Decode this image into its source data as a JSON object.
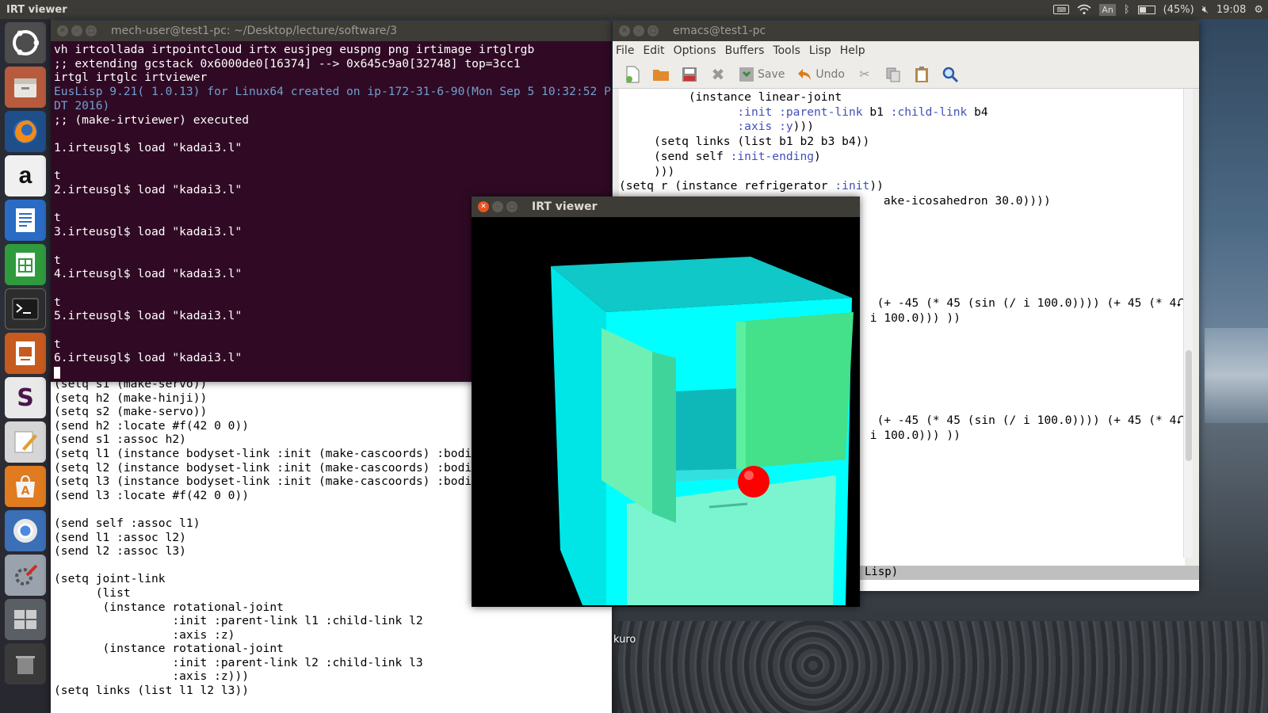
{
  "top_panel": {
    "app_title": "IRT viewer",
    "lang_indicator": "An",
    "battery": "(45%)",
    "battery_level": 0.45,
    "clock": "19:08"
  },
  "launcher": {
    "items": [
      "ubuntu-dash",
      "files",
      "firefox",
      "amazon",
      "writer",
      "calc",
      "terminal",
      "impress",
      "slack",
      "text-editor",
      "software-center",
      "chromium",
      "settings",
      "workspace-switcher",
      "trash"
    ]
  },
  "terminal": {
    "title": "mech-user@test1-pc: ~/Desktop/lecture/software/3",
    "lines": [
      {
        "text": "vh irtcollada irtpointcloud irtx eusjpeg euspng png irtimage irtglrgb",
        "style": "normal"
      },
      {
        "text": ";; extending gcstack 0x6000de0[16374] --> 0x645c9a0[32748] top=3cc1",
        "style": "normal"
      },
      {
        "text": "irtgl irtglc irtviewer",
        "style": "normal"
      },
      {
        "text": "EusLisp 9.21( 1.0.13) for Linux64 created on ip-172-31-6-90(Mon Sep 5 10:32:52 P",
        "style": "info"
      },
      {
        "text": "DT 2016)",
        "style": "info"
      },
      {
        "text": ";; (make-irtviewer) executed",
        "style": "normal"
      },
      {
        "text": "",
        "style": "normal"
      },
      {
        "text": "1.irteusgl$ load \"kadai3.l\"",
        "style": "normal"
      },
      {
        "text": "",
        "style": "normal"
      },
      {
        "text": "t",
        "style": "normal"
      },
      {
        "text": "2.irteusgl$ load \"kadai3.l\"",
        "style": "normal"
      },
      {
        "text": "",
        "style": "normal"
      },
      {
        "text": "t",
        "style": "normal"
      },
      {
        "text": "3.irteusgl$ load \"kadai3.l\"",
        "style": "normal"
      },
      {
        "text": "",
        "style": "normal"
      },
      {
        "text": "t",
        "style": "normal"
      },
      {
        "text": "4.irteusgl$ load \"kadai3.l\"",
        "style": "normal"
      },
      {
        "text": "",
        "style": "normal"
      },
      {
        "text": "t",
        "style": "normal"
      },
      {
        "text": "5.irteusgl$ load \"kadai3.l\"",
        "style": "normal"
      },
      {
        "text": "",
        "style": "normal"
      },
      {
        "text": "t",
        "style": "normal"
      },
      {
        "text": "6.irteusgl$ load \"kadai3.l\"",
        "style": "normal"
      }
    ]
  },
  "left_editor": {
    "lines": [
      "(setq s1 (make-servo))",
      "(setq h2 (make-hinji))",
      "(setq s2 (make-servo))",
      "(send h2 :locate #f(42 0 0))",
      "(send s1 :assoc h2)",
      "(setq l1 (instance bodyset-link :init (make-cascoords) :bodi",
      "(setq l2 (instance bodyset-link :init (make-cascoords) :bodi",
      "(setq l3 (instance bodyset-link :init (make-cascoords) :bodi",
      "(send l3 :locate #f(42 0 0))",
      "",
      "(send self :assoc l1)",
      "(send l1 :assoc l2)",
      "(send l2 :assoc l3)",
      "",
      "(setq joint-link",
      "      (list",
      "       (instance rotational-joint",
      "                 :init :parent-link l1 :child-link l2",
      "                 :axis :z)",
      "       (instance rotational-joint",
      "                 :init :parent-link l2 :child-link l3",
      "                 :axis :z)))",
      "(setq links (list l1 l2 l3))"
    ]
  },
  "emacs": {
    "title": "emacs@test1-pc",
    "menu": [
      "File",
      "Edit",
      "Options",
      "Buffers",
      "Tools",
      "Lisp",
      "Help"
    ],
    "toolbar": {
      "save_label": "Save",
      "undo_label": "Undo"
    },
    "code_lines": [
      {
        "indent": "          ",
        "parts": [
          {
            "t": "(instance linear-joint",
            "k": false
          }
        ]
      },
      {
        "indent": "                 ",
        "parts": [
          {
            "t": ":init :parent-link",
            "k": true
          },
          {
            "t": " b1 ",
            "k": false
          },
          {
            "t": ":child-link",
            "k": true
          },
          {
            "t": " b4",
            "k": false
          }
        ]
      },
      {
        "indent": "                 ",
        "parts": [
          {
            "t": ":axis :y",
            "k": true
          },
          {
            "t": ")))",
            "k": false
          }
        ]
      },
      {
        "indent": "     ",
        "parts": [
          {
            "t": "(setq links (list b1 b2 b3 b4))",
            "k": false
          }
        ]
      },
      {
        "indent": "     ",
        "parts": [
          {
            "t": "(send self ",
            "k": false
          },
          {
            "t": ":init-ending",
            "k": true
          },
          {
            "t": ")",
            "k": false
          }
        ]
      },
      {
        "indent": "     ",
        "parts": [
          {
            "t": ")))",
            "k": false
          }
        ]
      },
      {
        "indent": "",
        "parts": [
          {
            "t": "(setq r (instance refrigerator ",
            "k": false
          },
          {
            "t": ":init",
            "k": true
          },
          {
            "t": "))",
            "k": false
          }
        ]
      },
      {
        "indent": "",
        "parts": [
          {
            "t": "                                      ake-icosahedron 30.0))))",
            "k": false
          }
        ]
      }
    ],
    "fragment_1": [
      "  (+ -45 (* 45 (sin (/ i 100.0)))) (+ 45 (* 4⮏",
      " i 100.0))) ))"
    ],
    "fragment_2": [
      "  (+ -45 (* 45 (sin (/ i 100.0)))) (+ 45 (* 4⮏",
      " i 100.0))) ))"
    ],
    "modeline": "Lisp)"
  },
  "desktop": {
    "icon_label": "kuro"
  },
  "irt_viewer": {
    "title": "IRT viewer",
    "colors": {
      "body": "#00ffff",
      "door": "#44e08a",
      "lower_door": "#7af5cf",
      "ball": "#ff0000",
      "background": "#000000"
    }
  }
}
